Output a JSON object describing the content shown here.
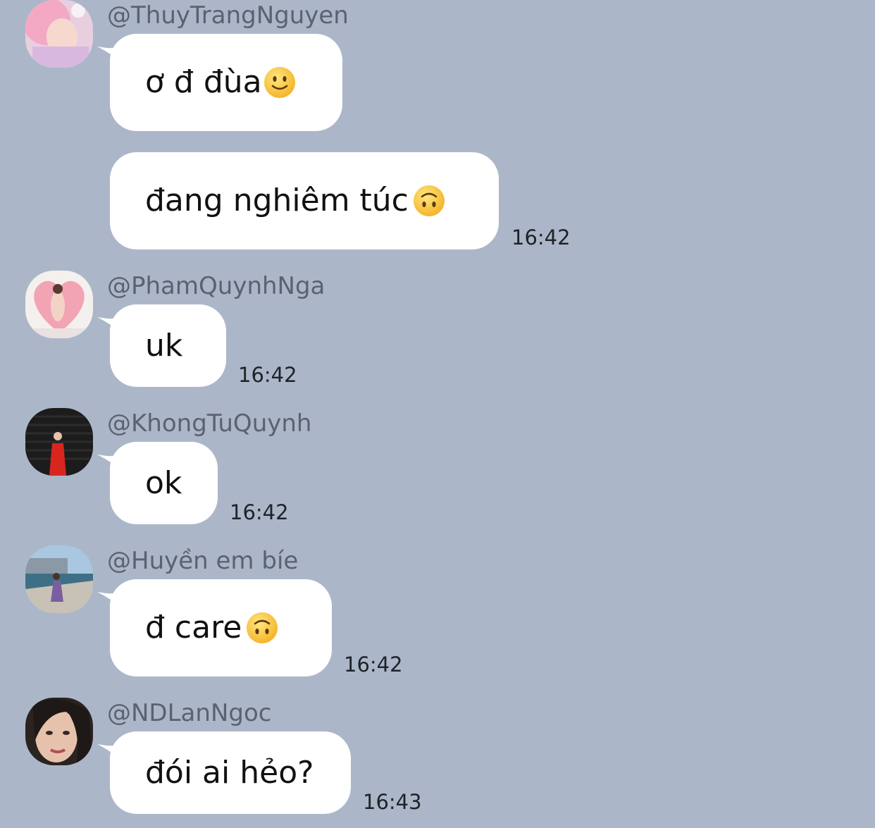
{
  "messages": [
    {
      "username": "@ThuyTrangNguyen",
      "bubbles": [
        {
          "text": "ơ đ đùa",
          "emoji": "slightly-smiling-face-emoji"
        },
        {
          "text": "đang nghiêm túc ",
          "emoji": "upside-down-face-emoji"
        }
      ],
      "time": "16:42"
    },
    {
      "username": "@PhamQuynhNga",
      "bubbles": [
        {
          "text": "uk"
        }
      ],
      "time": "16:42"
    },
    {
      "username": "@KhongTuQuynh",
      "bubbles": [
        {
          "text": "ok"
        }
      ],
      "time": "16:42"
    },
    {
      "username": "@Huyền em bíe",
      "bubbles": [
        {
          "text": "đ care ",
          "emoji": "upside-down-face-emoji"
        }
      ],
      "time": "16:42"
    },
    {
      "username": "@NDLanNgoc",
      "bubbles": [
        {
          "text": "đói ai hẻo?"
        }
      ],
      "time": "16:43"
    }
  ],
  "colors": {
    "background": "#abb7c9",
    "bubble": "#ffffff",
    "username": "#5a6270"
  }
}
